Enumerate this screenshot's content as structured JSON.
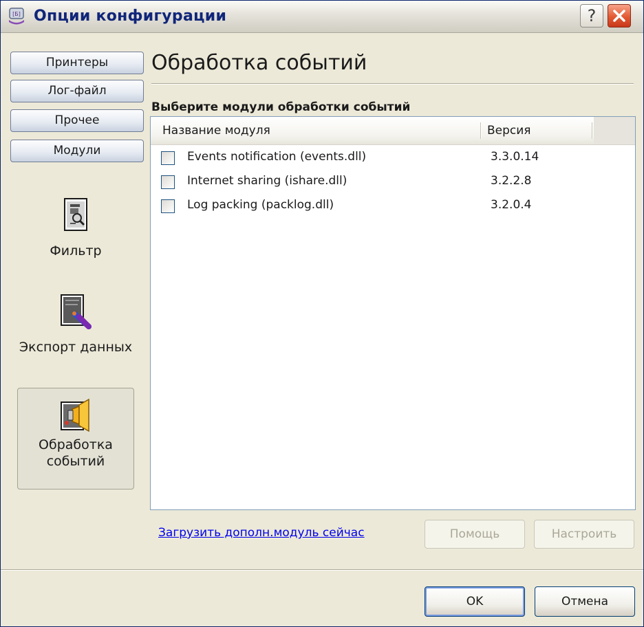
{
  "window": {
    "title": "Опции конфигурации",
    "help_glyph": "?"
  },
  "nav": {
    "buttons": [
      "Принтеры",
      "Лог-файл",
      "Прочее",
      "Модули"
    ],
    "tools": [
      {
        "label": "Фильтр",
        "icon": "filter-icon"
      },
      {
        "label": "Экспорт данных",
        "icon": "export-icon"
      },
      {
        "label": "Обработка событий",
        "icon": "event-handling-icon",
        "active": true
      }
    ]
  },
  "main": {
    "title": "Обработка событий",
    "section_label": "Выберите модули обработки событий",
    "columns": [
      "Название модуля",
      "Версия"
    ],
    "modules": [
      {
        "name": "Events notification (events.dll)",
        "version": "3.3.0.14",
        "checked": false
      },
      {
        "name": "Internet sharing (ishare.dll)",
        "version": "3.2.2.8",
        "checked": false
      },
      {
        "name": "Log packing (packlog.dll)",
        "version": "3.2.0.4",
        "checked": false
      }
    ],
    "download_link": "Загрузить дополн.модуль сейчас",
    "help_button": "Помощь",
    "configure_button": "Настроить"
  },
  "footer": {
    "ok_button": "OK",
    "cancel_button": "Отмена"
  },
  "colors": {
    "title_text": "#10257a",
    "link": "#0000ee",
    "dialog_bg": "#ece9d8"
  }
}
